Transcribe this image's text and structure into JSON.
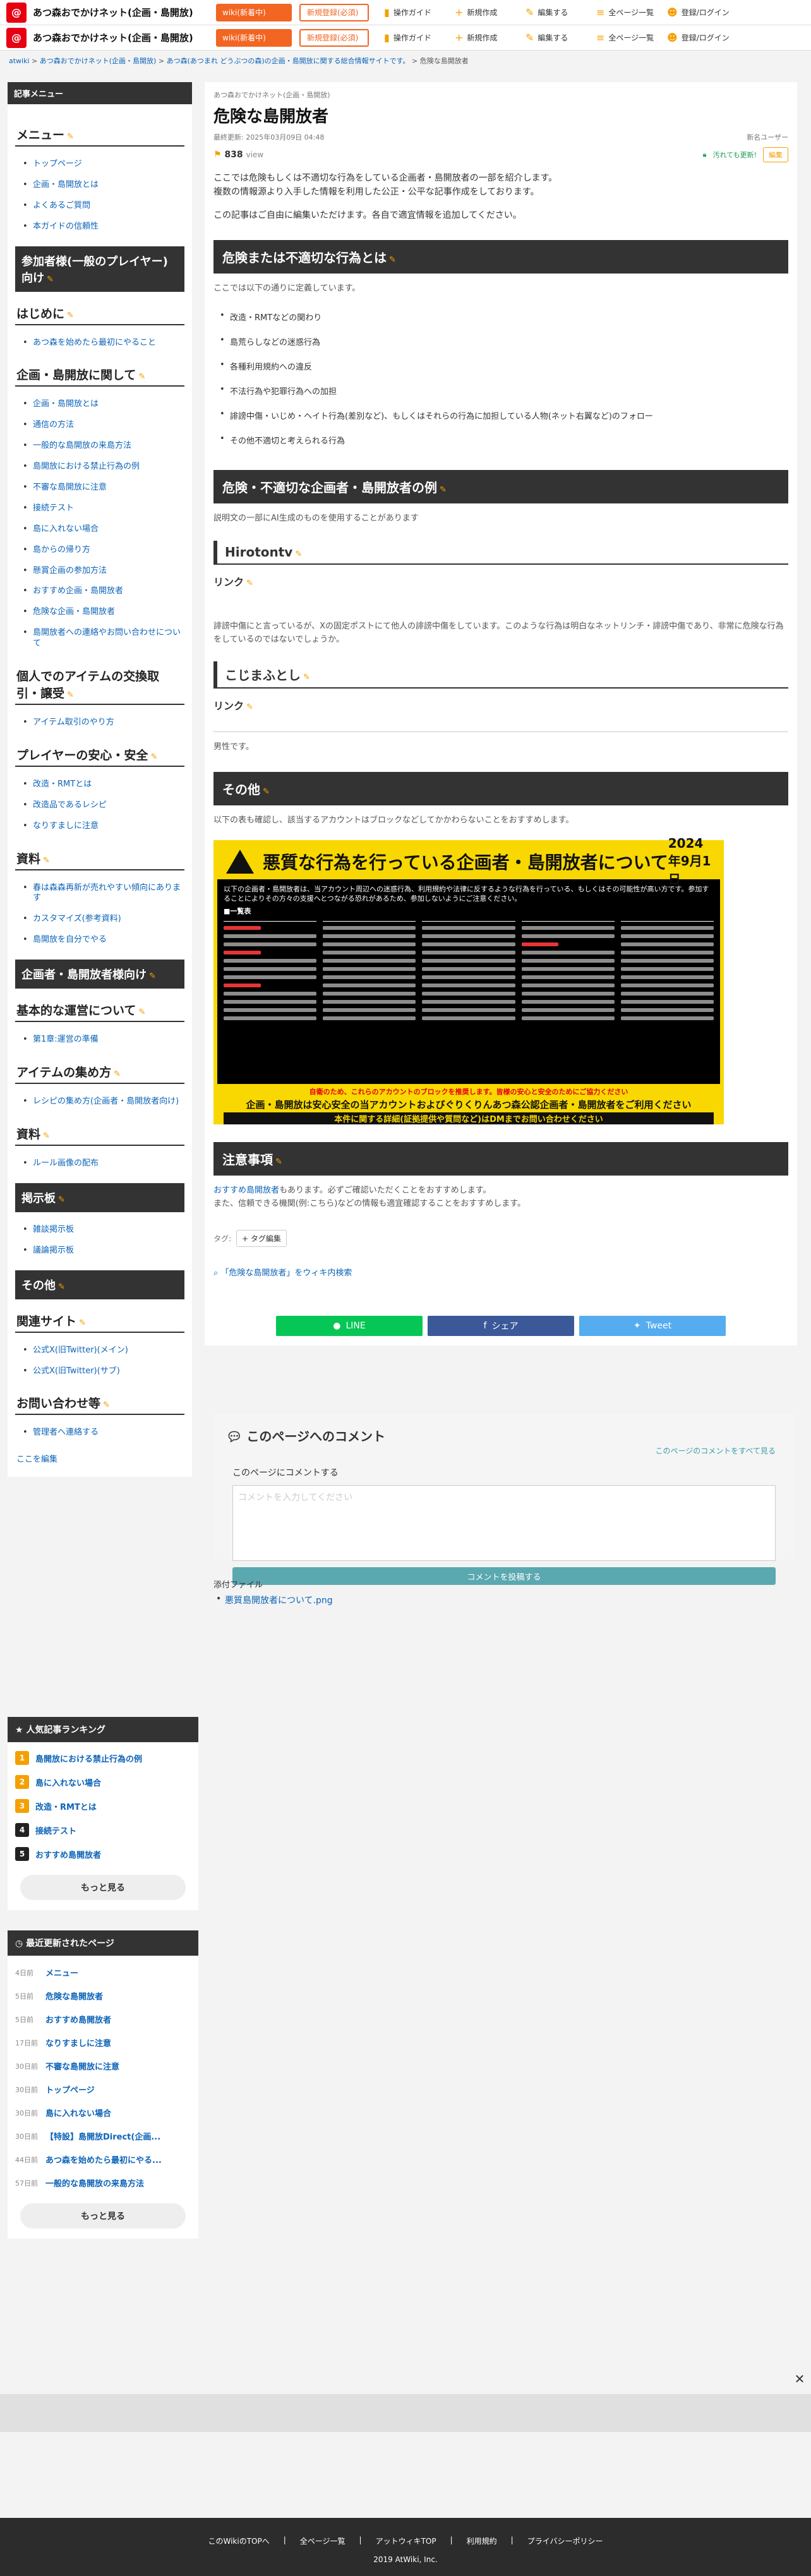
{
  "header": {
    "logo": "@",
    "site_title": "あつ森おでかけネット(企画・島開放)",
    "wiki_btn": "wiki(新着中)",
    "register_btn": "新規登録(必須)",
    "links": [
      "操作ガイド",
      "新規作成",
      "編集する",
      "全ページ一覧",
      "登録/ログイン"
    ]
  },
  "breadcrumb": {
    "items": [
      "atwiki",
      "あつ森おでかけネット(企画・島開放)",
      "あつ森(あつまれ どうぶつの森)の企画・島開放に関する総合情報サイトです。",
      "危険な島開放者"
    ],
    "sep": " > "
  },
  "sidebar": {
    "head": "記事メニュー",
    "menu_title": "メニュー",
    "menu_items": [
      "トップページ",
      "企画・島開放とは",
      "よくあるご質問",
      "本ガイドの信頼性"
    ],
    "participants_title": "参加者様(一般のプレイヤー)向け",
    "start_title": "はじめに",
    "start_items": [
      "あつ森を始めたら最初にやること"
    ],
    "kikaku_title": "企画・島開放に関して",
    "kikaku_items": [
      "企画・島開放とは",
      "通信の方法",
      "一般的な島開放の来島方法",
      "島開放における禁止行為の例",
      "不審な島開放に注意",
      "接続テスト",
      "島に入れない場合",
      "島からの帰り方",
      "懸賞企画の参加方法",
      "おすすめ企画・島開放者",
      "危険な企画・島開放者",
      "島開放者への連絡やお問い合わせについて"
    ],
    "trade_title": "個人でのアイテムの交換取引・譲受",
    "trade_items": [
      "アイテム取引のやり方"
    ],
    "safety_title": "プレイヤーの安心・安全",
    "safety_items": [
      "改造・RMTとは",
      "改造品であるレシピ",
      "なりすましに注意"
    ],
    "res_title": "資料",
    "res_items": [
      "春は森森再新が売れやすい傾向にあります",
      "カスタマイズ(参考資料)",
      "島開放を自分でやる"
    ],
    "host_title": "企画者・島開放者様向け",
    "basic_title": "基本的な運営について",
    "basic_items": [
      "第1章:運営の準備"
    ],
    "items_title": "アイテムの集め方",
    "items_items": [
      "レシピの集め方(企画者・島開放者向け)"
    ],
    "res2_title": "資料",
    "res2_items": [
      "ルール画像の配布"
    ],
    "board_title": "掲示板",
    "board_items": [
      "雑談掲示板",
      "議論掲示板"
    ],
    "other_title": "その他",
    "related_title": "関連サイト",
    "related_items": [
      "公式X(旧Twitter)(メイン)",
      "公式X(旧Twitter)(サブ)"
    ],
    "contact_title": "お問い合わせ等",
    "contact_items": [
      "管理者へ連絡する"
    ],
    "edit_here": "ここを編集"
  },
  "ranking": {
    "head": "人気記事ランキング",
    "items": [
      {
        "n": "1",
        "label": "島開放における禁止行為の例",
        "color": "#f5a000"
      },
      {
        "n": "2",
        "label": "島に入れない場合",
        "color": "#f5a000"
      },
      {
        "n": "3",
        "label": "改造・RMTとは",
        "color": "#f5a000"
      },
      {
        "n": "4",
        "label": "接続テスト",
        "color": "#222222"
      },
      {
        "n": "5",
        "label": "おすすめ島開放者",
        "color": "#222222"
      }
    ],
    "more": "もっと見る"
  },
  "recent": {
    "head": "最近更新されたページ",
    "items": [
      {
        "d": "4日前",
        "label": "メニュー"
      },
      {
        "d": "5日前",
        "label": "危険な島開放者"
      },
      {
        "d": "5日前",
        "label": "おすすめ島開放者"
      },
      {
        "d": "17日前",
        "label": "なりすましに注意"
      },
      {
        "d": "30日前",
        "label": "不審な島開放に注意"
      },
      {
        "d": "30日前",
        "label": "トップページ"
      },
      {
        "d": "30日前",
        "label": "島に入れない場合"
      },
      {
        "d": "30日前",
        "label": "【特設】島開放Direct(企画..."
      },
      {
        "d": "44日前",
        "label": "あつ森を始めたら最初にやる..."
      },
      {
        "d": "57日前",
        "label": "一般的な島開放の来島方法"
      }
    ],
    "more": "もっと見る"
  },
  "article": {
    "sub_title": "あつ森おでかけネット(企画・島開放)",
    "title": "危険な島開放者",
    "updated": "最終更新: 2025年03月09日 04:48",
    "editor": "新名ユーザー",
    "views": "838",
    "views_unit": "view",
    "safe_badge": "汚れても更新!",
    "edit_btn": "編集",
    "intro1": "ここでは危険もしくは不適切な行為をしている企画者・島開放者の一部を紹介します。",
    "intro2": "複数の情報源より入手した情報を利用した公正・公平な記事作成をしております。",
    "intro3": "この記事はご自由に編集いただけます。各自で適宜情報を追加してください。",
    "sec1_title": "危険または不適切な行為とは",
    "sec1_lead": "ここでは以下の通りに定義しています。",
    "sec1_items": [
      "改造・RMTなどの関わり",
      "島荒らしなどの迷惑行為",
      "各種利用規約への違反",
      "不法行為や犯罪行為への加担",
      "誹謗中傷・いじめ・ヘイト行為(差別など)、もしくはそれらの行為に加担している人物(ネット右翼など)のフォロー",
      "その他不適切と考えられる行為"
    ],
    "sec2_title": "危険・不適切な企画者・島開放者の例",
    "sec2_note": "説明文の一部にAI生成のものを使用することがあります",
    "p1_name": "Hirotontv",
    "p1_link": "リンク",
    "p1_desc": "誹謗中傷にと言っているが、Xの固定ポストにて他人の誹謗中傷をしています。このような行為は明白なネットリンチ・誹謗中傷であり、非常に危険な行為をしているのではないでしょうか。",
    "p2_name": "こじまふとし",
    "p2_link": "リンク",
    "p2_desc": "男性です。",
    "sec3_title": "その他",
    "sec3_text": "以下の表も確認し、該当するアカウントはブロックなどしてかかわらないことをおすすめします。",
    "img_title": "悪質な行為を行っている企画者・島開放者について",
    "img_date": "2024年9月1日",
    "img_body": "以下の企画者・島開放者は、当アカウント周辺への迷惑行為、利用規約や法律に反するような行為を行っている、もしくはその可能性が高い方です。参加することによりその方々の支援へとつながる恐れがあるため、参加しないようにご注意ください。",
    "img_list": "■一覧表",
    "img_f1": "自衛のため、これらのアカウントのブロックを推奨します。皆様の安心と安全のためにご協力ください",
    "img_f2": "企画・島開放は安心安全の当アカウントおよびぐりくりんあつ森公認企画者・島開放者をご利用ください",
    "img_f3": "本件に関する詳細(証拠提供や質問など)はDMまでお問い合わせください",
    "sec4_title": "注意事項",
    "sec4_p1_link": "おすすめ島開放者",
    "sec4_p1_rest": "もあります。必ずご確認いただくことをおすすめします。",
    "sec4_p2": "また、信頼できる機関(例:こちら)などの情報も適宜確認することをおすすめします。",
    "tag_label": "タグ:",
    "tag_btn": "+ タグ編集",
    "search_wiki": "「危険な島開放者」をウィキ内検索"
  },
  "share": {
    "line": "LINE",
    "fb": "シェア",
    "tw": "Tweet",
    "colors": {
      "line": "#06c755",
      "fb": "#3b5998",
      "tw": "#55acee"
    }
  },
  "comment": {
    "title": "このページへのコメント",
    "all_link": "このページのコメントをすべて見る",
    "label": "このページにコメントする",
    "placeholder": "コメントを入力してください",
    "submit": "コメントを投稿する"
  },
  "attach": {
    "label": "添付ファイル",
    "items": [
      "悪質島開放者について.png"
    ]
  },
  "footer": {
    "links": [
      "このWikiのTOPへ",
      "全ページ一覧",
      "アットウィキTOP",
      "利用規約",
      "プライバシーポリシー"
    ],
    "copy": "2019 AtWiki, Inc."
  }
}
